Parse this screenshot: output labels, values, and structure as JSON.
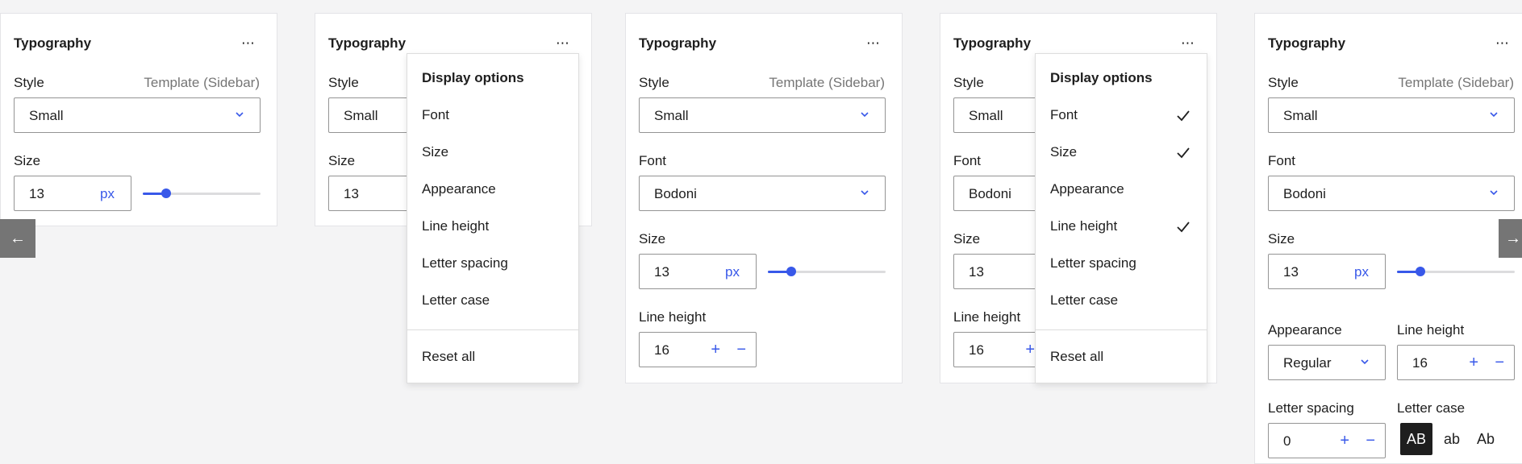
{
  "panels": [
    {
      "title": "Typography",
      "more": "⋯",
      "style_label": "Style",
      "style_hint": "Template (Sidebar)",
      "style_value": "Small",
      "size_label": "Size",
      "size_value": "13",
      "size_unit": "px",
      "size_slider_fraction": 0.2
    },
    {
      "title": "Typography",
      "more": "⋯",
      "style_label": "Style",
      "style_value": "Small",
      "size_label": "Size",
      "size_value": "13"
    },
    {
      "title": "Typography",
      "more": "⋯",
      "style_label": "Style",
      "style_hint": "Template (Sidebar)",
      "style_value": "Small",
      "font_label": "Font",
      "font_value": "Bodoni",
      "size_label": "Size",
      "size_value": "13",
      "size_unit": "px",
      "size_slider_fraction": 0.2,
      "line_height_label": "Line height",
      "line_height_value": "16",
      "plus": "+",
      "minus": "−"
    },
    {
      "title": "Typography",
      "more": "⋯",
      "style_label": "Style",
      "style_value": "Small",
      "font_label": "Font",
      "font_value": "Bodoni",
      "size_label": "Size",
      "size_value": "13",
      "line_height_label": "Line height",
      "line_height_value": "16",
      "plus": "+"
    },
    {
      "title": "Typography",
      "more": "⋯",
      "style_label": "Style",
      "style_hint": "Template (Sidebar)",
      "style_value": "Small",
      "font_label": "Font",
      "font_value": "Bodoni",
      "size_label": "Size",
      "size_value": "13",
      "size_unit": "px",
      "size_slider_fraction": 0.2,
      "appearance_label": "Appearance",
      "appearance_value": "Regular",
      "line_height_label": "Line height",
      "line_height_value": "16",
      "letter_spacing_label": "Letter spacing",
      "letter_spacing_value": "0",
      "letter_case_label": "Letter case",
      "letter_case_options": [
        "AB",
        "ab",
        "Ab"
      ],
      "letter_case_selected": "AB",
      "plus": "+",
      "minus": "−"
    }
  ],
  "menus": [
    {
      "header": "Display options",
      "items": [
        {
          "label": "Font",
          "checked": false
        },
        {
          "label": "Size",
          "checked": false
        },
        {
          "label": "Appearance",
          "checked": false
        },
        {
          "label": "Line height",
          "checked": false
        },
        {
          "label": "Letter spacing",
          "checked": false
        },
        {
          "label": "Letter case",
          "checked": false
        }
      ],
      "reset": "Reset all"
    },
    {
      "header": "Display options",
      "items": [
        {
          "label": "Font",
          "checked": true
        },
        {
          "label": "Size",
          "checked": true
        },
        {
          "label": "Appearance",
          "checked": false
        },
        {
          "label": "Line height",
          "checked": true
        },
        {
          "label": "Letter spacing",
          "checked": false
        },
        {
          "label": "Letter case",
          "checked": false
        }
      ],
      "reset": "Reset all"
    }
  ],
  "nav": {
    "prev_icon": "←",
    "next_icon": "→"
  },
  "colors": {
    "accent": "#3858e9",
    "hint": "#757575",
    "panel_bg": "#ffffff",
    "page_bg": "#f4f4f5"
  }
}
